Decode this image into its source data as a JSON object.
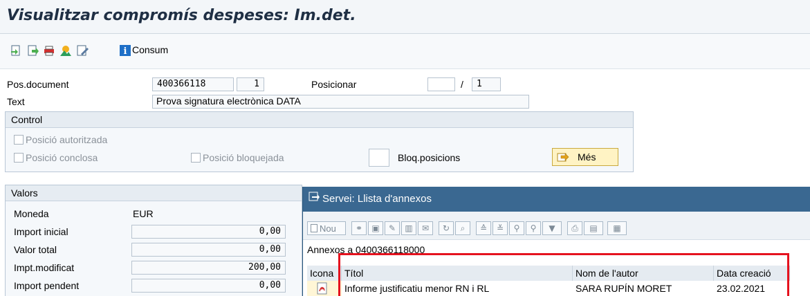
{
  "window": {
    "title": "Visualitzar compromís despeses: Im.det."
  },
  "toolbar": {
    "consum_label": "Consum",
    "icons": [
      "back-icon",
      "document-icon",
      "print-icon",
      "services-icon",
      "edit-icon",
      "info-icon"
    ]
  },
  "header": {
    "pos_document_label": "Pos.document",
    "document_number": "400366118",
    "position": "1",
    "posicionar_label": "Posicionar",
    "posicionar_value": "",
    "posicionar_separator": "/",
    "posicionar_total": "1",
    "text_label": "Text",
    "text_value": "Prova signatura electrònica DATA"
  },
  "control": {
    "title": "Control",
    "autoritzada_label": "Posició autoritzada",
    "conclosa_label": "Posició conclosa",
    "bloquejada_label": "Posició bloquejada",
    "bloq_posicions_label": "Bloq.posicions",
    "mes_button": "Més"
  },
  "valors": {
    "title": "Valors",
    "moneda_label": "Moneda",
    "moneda_value": "EUR",
    "rows": [
      {
        "label": "Import inicial",
        "value": "0,00"
      },
      {
        "label": "Valor total",
        "value": "0,00"
      },
      {
        "label": "Impt.modificat",
        "value": "200,00"
      },
      {
        "label": "Import pendent",
        "value": "0,00"
      }
    ]
  },
  "popup": {
    "title": "Servei: Llista d'annexos",
    "new_button": "Nou",
    "subtitle": "Annexos a 0400366118000",
    "columns": [
      "Icona",
      "Títol",
      "Nom de l'autor",
      "Data creació"
    ],
    "rows": [
      {
        "titol": "Informe justificatiu menor RN i RL",
        "autor": "SARA RUPÍN MORET",
        "data": "23.02.2021"
      }
    ]
  },
  "colors": {
    "popup_header": "#3a6891",
    "highlight": "#e5121e",
    "mes_button_bg": "#fff3c4"
  }
}
